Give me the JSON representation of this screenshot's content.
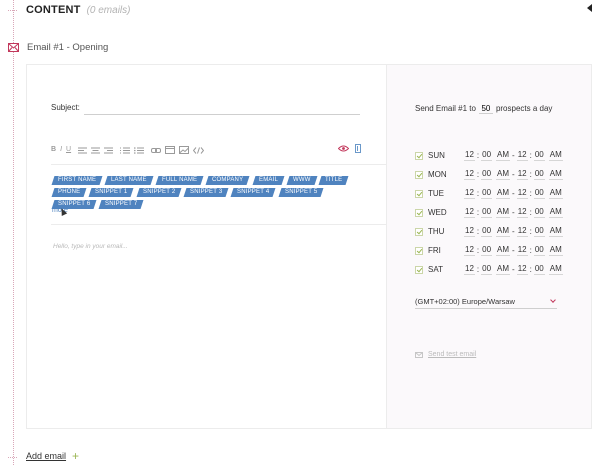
{
  "section": {
    "title": "CONTENT",
    "email_count": "(0 emails)"
  },
  "email": {
    "label": "Email #1 - Opening"
  },
  "editor": {
    "subject_label": "Subject:",
    "subject_value": "",
    "toolbar": {
      "bold": "B",
      "italic": "I",
      "underline": "U"
    },
    "tags": [
      "FIRST NAME",
      "LAST NAME",
      "FULL NAME",
      "COMPANY",
      "EMAIL",
      "WWW",
      "TITLE",
      "PHONE",
      "SNIPPET 1",
      "SNIPPET 2",
      "SNIPPET 3",
      "SNIPPET 4",
      "SNIPPET 5",
      "SNIPPET 6",
      "SNIPPET 7"
    ],
    "more_label": "more",
    "body_placeholder": "Hello, type in your email..."
  },
  "settings": {
    "send_prefix": "Send Email #1 to",
    "daily_limit": "50",
    "send_suffix": "prospects a day",
    "days": [
      {
        "name": "SUN",
        "from_h": "12",
        "from_m": "00",
        "from_p": "AM",
        "to_h": "12",
        "to_m": "00",
        "to_p": "AM"
      },
      {
        "name": "MON",
        "from_h": "12",
        "from_m": "00",
        "from_p": "AM",
        "to_h": "12",
        "to_m": "00",
        "to_p": "AM"
      },
      {
        "name": "TUE",
        "from_h": "12",
        "from_m": "00",
        "from_p": "AM",
        "to_h": "12",
        "to_m": "00",
        "to_p": "AM"
      },
      {
        "name": "WED",
        "from_h": "12",
        "from_m": "00",
        "from_p": "AM",
        "to_h": "12",
        "to_m": "00",
        "to_p": "AM"
      },
      {
        "name": "THU",
        "from_h": "12",
        "from_m": "00",
        "from_p": "AM",
        "to_h": "12",
        "to_m": "00",
        "to_p": "AM"
      },
      {
        "name": "FRI",
        "from_h": "12",
        "from_m": "00",
        "from_p": "AM",
        "to_h": "12",
        "to_m": "00",
        "to_p": "AM"
      },
      {
        "name": "SAT",
        "from_h": "12",
        "from_m": "00",
        "from_p": "AM",
        "to_h": "12",
        "to_m": "00",
        "to_p": "AM"
      }
    ],
    "timezone": "(GMT+02:00) Europe/Warsaw",
    "send_test_label": "Send test email"
  },
  "footer": {
    "add_email_label": "Add email"
  },
  "colors": {
    "accent_pink": "#c2385c",
    "tag_blue": "#4f83bf",
    "check_green": "#9bb653"
  }
}
